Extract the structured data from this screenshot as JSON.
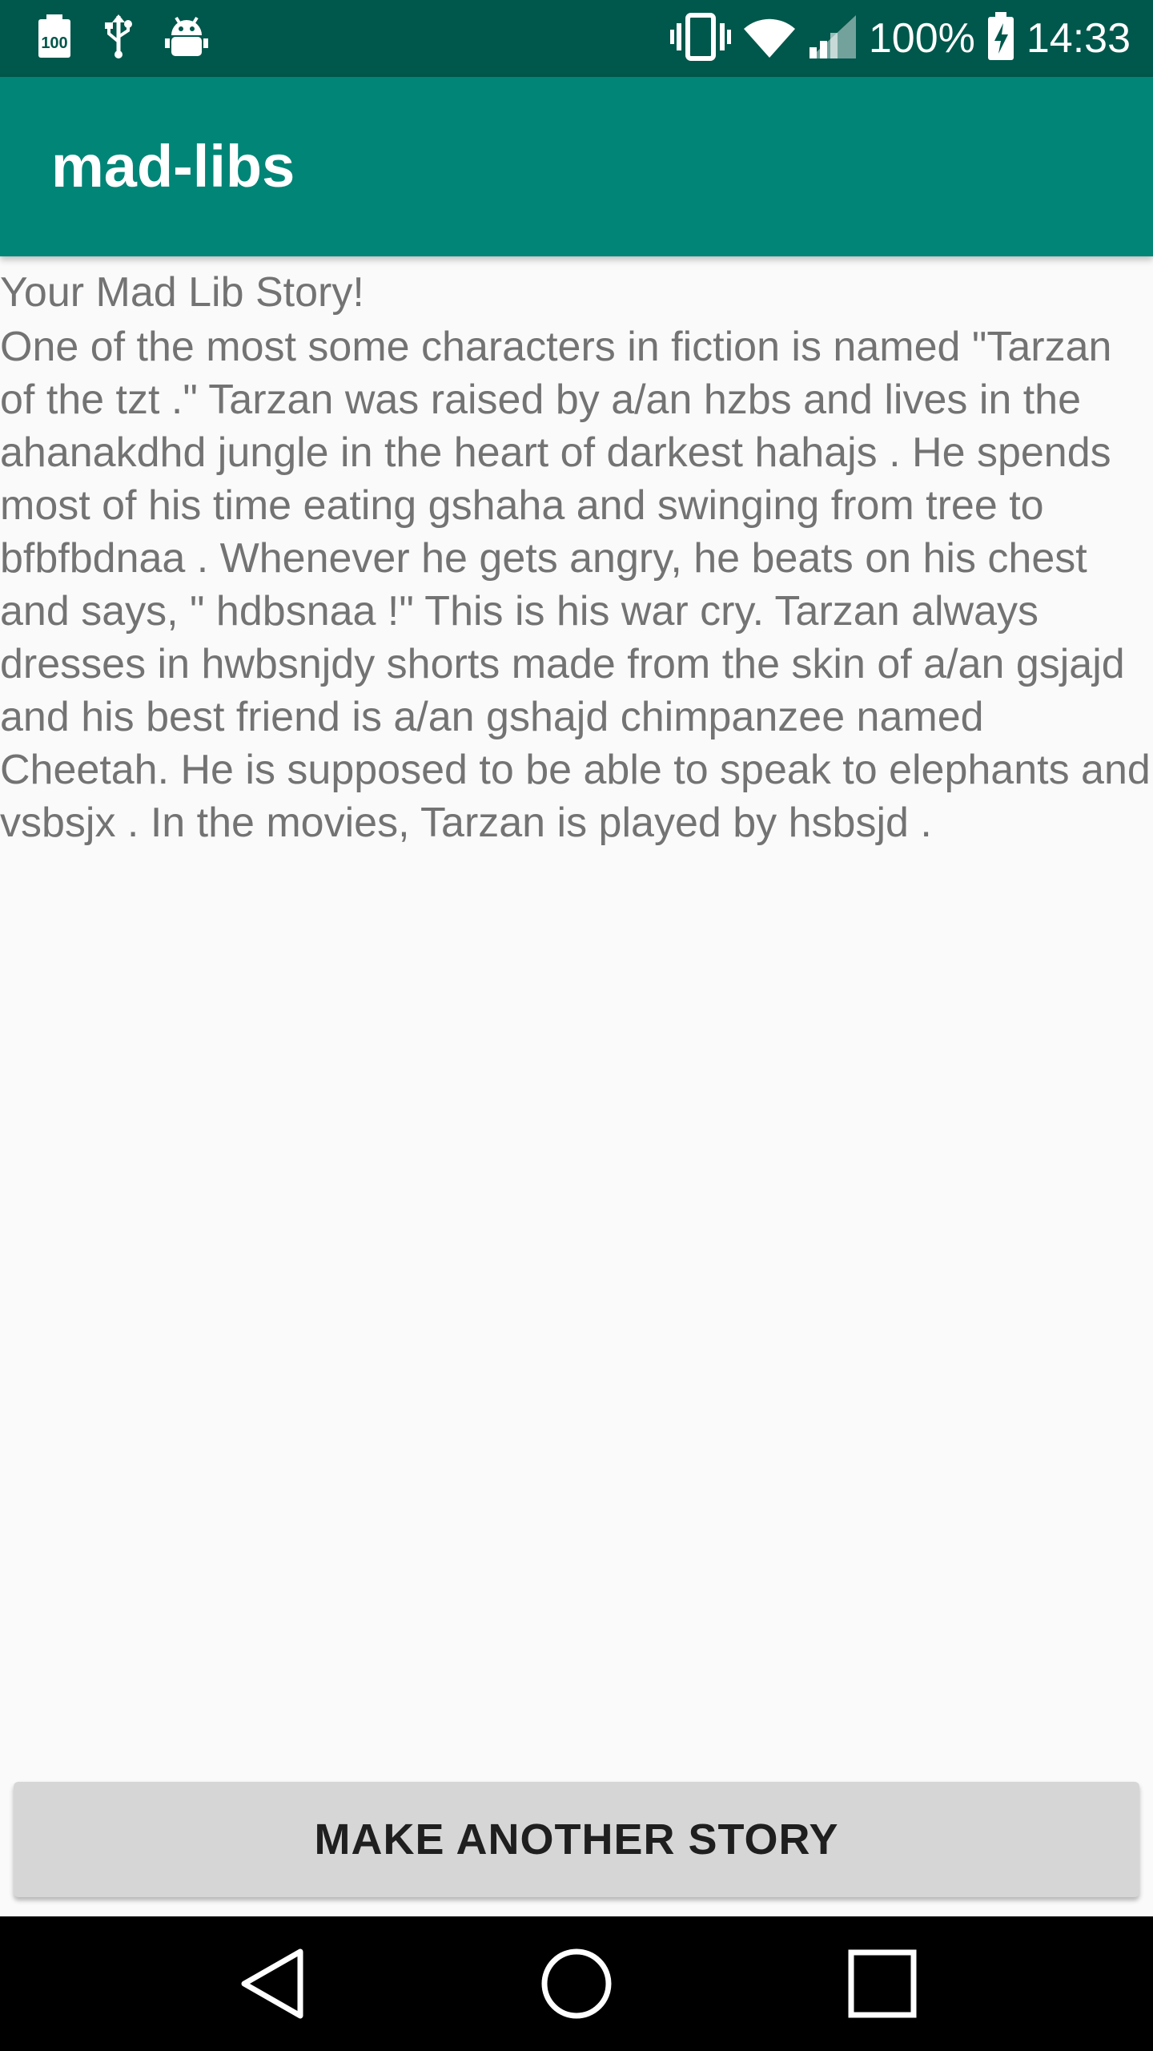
{
  "status_bar": {
    "battery_percent": "100%",
    "time": "14:33",
    "left_icons": [
      "battery-saver-icon",
      "usb-icon",
      "android-debug-icon"
    ],
    "right_icons": [
      "vibrate-icon",
      "wifi-icon",
      "signal-icon",
      "battery-charging-icon"
    ]
  },
  "app_bar": {
    "title": "mad-libs"
  },
  "story": {
    "heading": "Your Mad Lib Story!",
    "text": "One of the most some characters in fiction is named \"Tarzan of the tzt .\" Tarzan was raised by a/an hzbs and lives in the ahanakdhd jungle in the heart of darkest hahajs . He spends most of his time eating gshaha and swinging from tree to bfbfbdnaa . Whenever he gets angry, he beats on his chest and says, \" hdbsnaa !\" This is his war cry. Tarzan always dresses in hwbsnjdy  shorts made from the skin of a/an gsjajd and his best friend is a/an gshajd chimpanzee named Cheetah. He is supposed to be able to speak to elephants and vsbsjx . In the movies, Tarzan is played by hsbsjd ."
  },
  "actions": {
    "make_another_label": "MAKE ANOTHER STORY"
  },
  "nav_bar": {
    "icons": [
      "back-icon",
      "home-icon",
      "recents-icon"
    ]
  },
  "colors": {
    "status_bar": "#00574b",
    "app_bar": "#008577",
    "background": "#fafafa",
    "text": "#737373",
    "button": "#d6d6d6"
  }
}
